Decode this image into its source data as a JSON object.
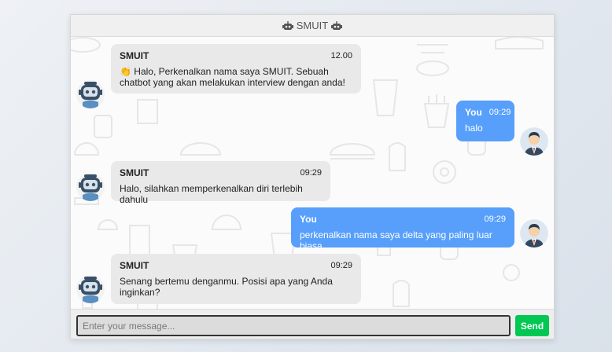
{
  "header": {
    "title": "SMUIT",
    "icon": "robot-icon"
  },
  "messages": [
    {
      "sender": "SMUIT",
      "time": "12.00",
      "text": "👏 Halo, Perkenalkan nama saya SMUIT. Sebuah chatbot yang akan melakukan interview dengan anda!",
      "side": "bot"
    },
    {
      "sender": "You",
      "time": "09:29",
      "text": "halo",
      "side": "user"
    },
    {
      "sender": "SMUIT",
      "time": "09:29",
      "text": "Halo, silahkan memperkenalkan diri terlebih dahulu",
      "side": "bot"
    },
    {
      "sender": "You",
      "time": "09:29",
      "text": "perkenalkan nama saya delta yang paling luar biasa",
      "side": "user"
    },
    {
      "sender": "SMUIT",
      "time": "09:29",
      "text": "Senang bertemu denganmu. Posisi apa yang Anda inginkan?",
      "side": "bot"
    }
  ],
  "input": {
    "placeholder": "Enter your message...",
    "value": ""
  },
  "send_label": "Send",
  "colors": {
    "user_bubble": "#579ffb",
    "bot_bubble": "#e9e9e9",
    "send_button": "#00c853"
  }
}
